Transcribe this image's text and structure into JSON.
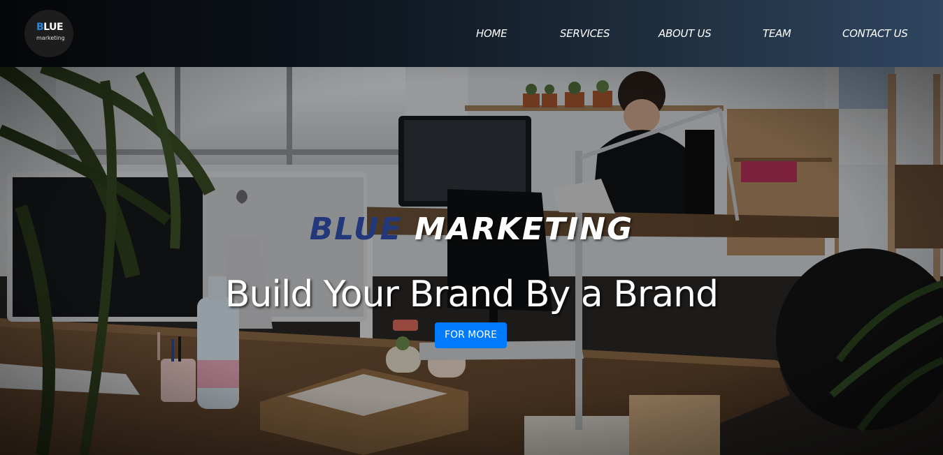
{
  "logo": {
    "mark_letter": "B",
    "mark_rest": "LUE",
    "subtitle": "marketing"
  },
  "nav": {
    "home": "HOME",
    "services": "SERVICES",
    "about": "ABOUT US",
    "team": "TEAM",
    "contact": "CONTACT US"
  },
  "hero": {
    "brand_first": "BLUE",
    "brand_second": "MARKETING",
    "tagline": "Build Your Brand By a Brand",
    "cta": "FOR MORE"
  },
  "colors": {
    "accent": "#007bff",
    "brand_blue": "#23387a",
    "nav_dark": "#050608",
    "nav_light": "#2f4660"
  }
}
